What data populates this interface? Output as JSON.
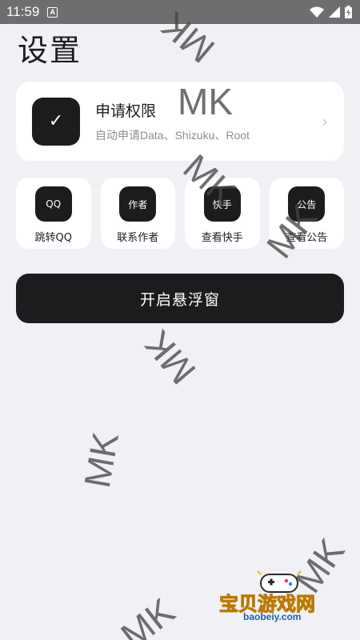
{
  "status_bar": {
    "time": "11:59",
    "notification_letter": "A"
  },
  "page": {
    "title": "设置"
  },
  "permission_card": {
    "icon_glyph": "✓",
    "title": "申请权限",
    "subtitle": "自动申请Data、Shizuku、Root",
    "chevron": "›"
  },
  "quick_actions": [
    {
      "icon_text": "QQ",
      "label": "跳转QQ"
    },
    {
      "icon_text": "作者",
      "label": "联系作者"
    },
    {
      "icon_text": "快手",
      "label": "查看快手"
    },
    {
      "icon_text": "公告",
      "label": "查看公告"
    }
  ],
  "float_button": {
    "label": "开启悬浮窗"
  },
  "watermark": {
    "text": "MK"
  },
  "logo": {
    "name": "宝贝游戏网",
    "url": "baobeiy.com"
  },
  "colors": {
    "accent": "#1c1c1e",
    "background": "#f1f0f5",
    "card": "#ffffff",
    "status_bar": "#6e6e6e"
  },
  "icons": [
    "notification-a-icon",
    "wifi-icon",
    "signal-icon",
    "battery-icon",
    "check-icon",
    "chevron-right-icon"
  ]
}
